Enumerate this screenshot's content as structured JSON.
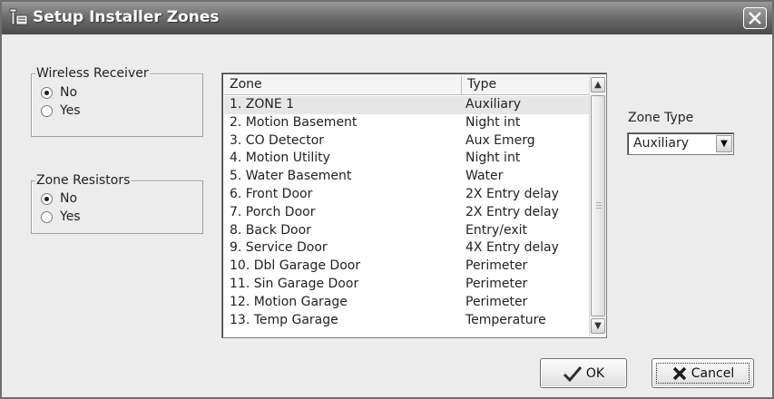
{
  "window": {
    "title": "Setup Installer Zones",
    "close_symbol": "✕"
  },
  "wireless_receiver": {
    "legend": "Wireless Receiver",
    "options": [
      {
        "label": "No",
        "checked": true
      },
      {
        "label": "Yes",
        "checked": false
      }
    ]
  },
  "zone_resistors": {
    "legend": "Zone Resistors",
    "options": [
      {
        "label": "No",
        "checked": true
      },
      {
        "label": "Yes",
        "checked": false
      }
    ]
  },
  "zone_list": {
    "columns": [
      "Zone",
      "Type"
    ],
    "rows": [
      {
        "zone": "1. ZONE 1",
        "type": "Auxiliary"
      },
      {
        "zone": "2. Motion Basement",
        "type": "Night int"
      },
      {
        "zone": "3. CO Detector",
        "type": "Aux Emerg"
      },
      {
        "zone": "4. Motion Utility",
        "type": "Night int"
      },
      {
        "zone": "5. Water Basement",
        "type": "Water"
      },
      {
        "zone": "6. Front Door",
        "type": "2X Entry delay"
      },
      {
        "zone": "7. Porch Door",
        "type": "2X Entry delay"
      },
      {
        "zone": "8. Back Door",
        "type": "Entry/exit"
      },
      {
        "zone": "9. Service Door",
        "type": "4X Entry delay"
      },
      {
        "zone": "10. Dbl Garage Door",
        "type": "Perimeter"
      },
      {
        "zone": "11. Sin Garage Door",
        "type": "Perimeter"
      },
      {
        "zone": "12. Motion Garage",
        "type": "Perimeter"
      },
      {
        "zone": "13. Temp Garage",
        "type": "Temperature"
      }
    ],
    "selected_index": 0
  },
  "zone_type": {
    "label": "Zone Type",
    "value": "Auxiliary"
  },
  "buttons": {
    "ok": "OK",
    "cancel": "Cancel"
  },
  "icons": {
    "title": "installer-tool-icon",
    "close": "close-icon",
    "ok": "checkmark-icon",
    "cancel": "x-icon"
  },
  "colors": {
    "ok_check": "#2e2e2e",
    "cancel_x": "#1a1a1a"
  }
}
